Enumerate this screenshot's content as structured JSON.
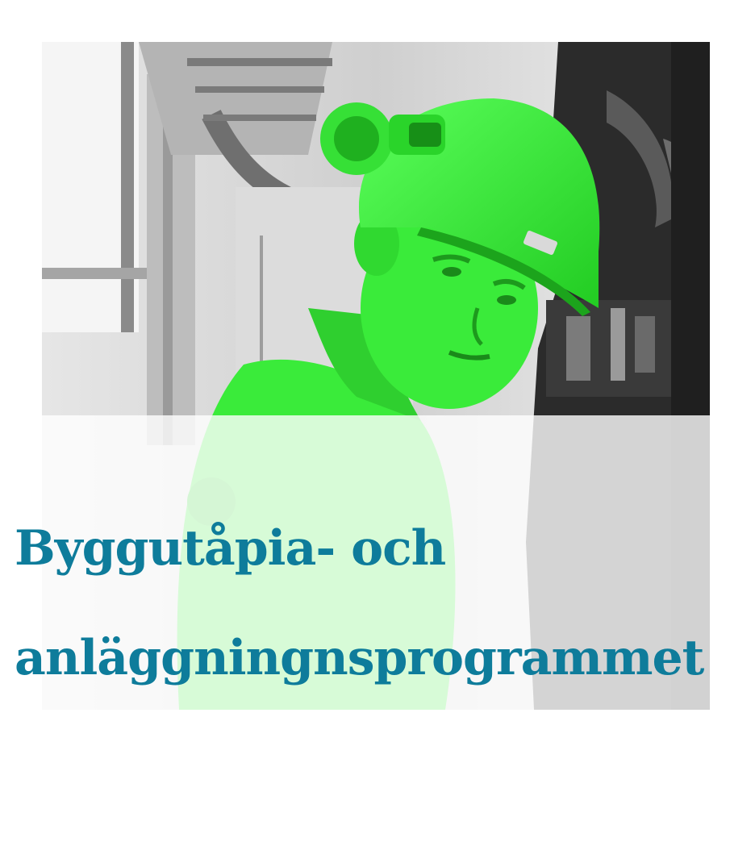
{
  "colors": {
    "title": "#0e7c9b",
    "highlight": "#3aeb3a",
    "photo_gray": "#d9d9d9"
  },
  "heading": {
    "line1": "Byggutåpia- och",
    "line2": "anläggningnsprogrammet"
  }
}
